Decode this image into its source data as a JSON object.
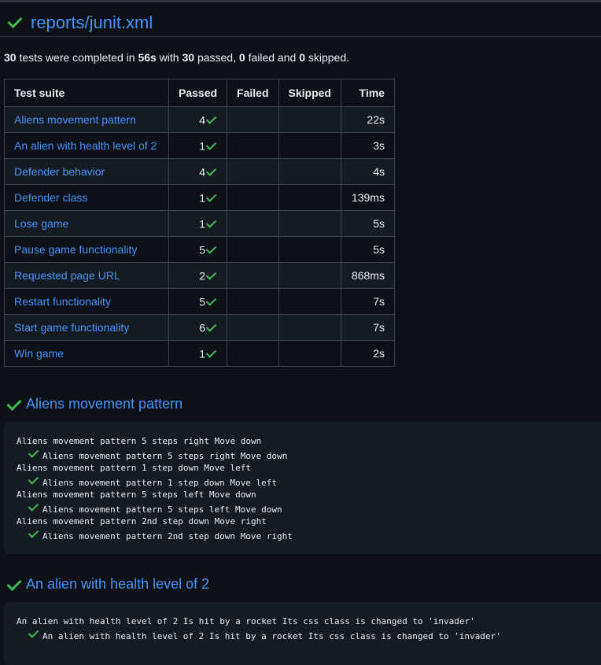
{
  "report": {
    "title": "reports/junit.xml"
  },
  "summary": {
    "total": "30",
    "text1": " tests were completed in ",
    "duration": "56s",
    "text2": " with ",
    "passed": "30",
    "text3": " passed, ",
    "failed": "0",
    "text4": " failed and ",
    "skipped": "0",
    "text5": " skipped."
  },
  "table": {
    "headers": [
      "Test suite",
      "Passed",
      "Failed",
      "Skipped",
      "Time"
    ],
    "rows": [
      {
        "suite": "Aliens movement pattern",
        "passed": "4",
        "failed": "",
        "skipped": "",
        "time": "22s"
      },
      {
        "suite": "An alien with health level of 2",
        "passed": "1",
        "failed": "",
        "skipped": "",
        "time": "3s"
      },
      {
        "suite": "Defender behavior",
        "passed": "4",
        "failed": "",
        "skipped": "",
        "time": "4s"
      },
      {
        "suite": "Defender class",
        "passed": "1",
        "failed": "",
        "skipped": "",
        "time": "139ms"
      },
      {
        "suite": "Lose game",
        "passed": "1",
        "failed": "",
        "skipped": "",
        "time": "5s"
      },
      {
        "suite": "Pause game functionality",
        "passed": "5",
        "failed": "",
        "skipped": "",
        "time": "5s"
      },
      {
        "suite": "Requested page URL",
        "passed": "2",
        "failed": "",
        "skipped": "",
        "time": "868ms"
      },
      {
        "suite": "Restart functionality",
        "passed": "5",
        "failed": "",
        "skipped": "",
        "time": "7s"
      },
      {
        "suite": "Start game functionality",
        "passed": "6",
        "failed": "",
        "skipped": "",
        "time": "7s"
      },
      {
        "suite": "Win game",
        "passed": "1",
        "failed": "",
        "skipped": "",
        "time": "2s"
      }
    ]
  },
  "sections": [
    {
      "title": "Aliens movement pattern",
      "lines": [
        {
          "text": "Aliens movement pattern 5 steps right Move down",
          "child": false
        },
        {
          "text": "Aliens movement pattern 5 steps right Move down",
          "child": true
        },
        {
          "text": "Aliens movement pattern 1 step down Move left",
          "child": false
        },
        {
          "text": "Aliens movement pattern 1 step down Move left",
          "child": true
        },
        {
          "text": "Aliens movement pattern 5 steps left Move down",
          "child": false
        },
        {
          "text": "Aliens movement pattern 5 steps left Move down",
          "child": true
        },
        {
          "text": "Aliens movement pattern 2nd step down Move right",
          "child": false
        },
        {
          "text": "Aliens movement pattern 2nd step down Move right",
          "child": true
        }
      ]
    },
    {
      "title": "An alien with health level of 2",
      "lines": [
        {
          "text": "An alien with health level of 2 Is hit by a rocket Its css class is changed to 'invader'",
          "child": false
        },
        {
          "text": "An alien with health level of 2 Is hit by a rocket Its css class is changed to 'invader'",
          "child": true
        }
      ]
    }
  ],
  "colors": {
    "background": "#0d1117",
    "link": "#4493f8",
    "success": "#3fb950",
    "border": "#3d444d",
    "code_bg": "#151b23"
  },
  "icons": {
    "status": "check-icon"
  }
}
